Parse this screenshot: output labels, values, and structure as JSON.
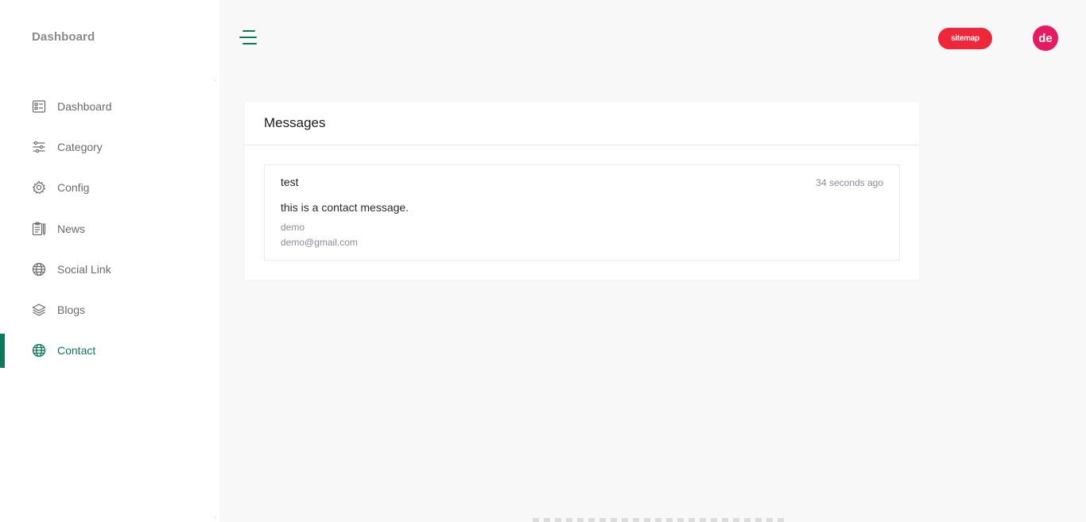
{
  "sidebar": {
    "brand": "Dashboard",
    "items": [
      {
        "label": "Dashboard",
        "icon": "dashboard-icon",
        "active": false
      },
      {
        "label": "Category",
        "icon": "sliders-icon",
        "active": false
      },
      {
        "label": "Config",
        "icon": "gear-icon",
        "active": false
      },
      {
        "label": "News",
        "icon": "clipboard-icon",
        "active": false
      },
      {
        "label": "Social Link",
        "icon": "globe-icon",
        "active": false
      },
      {
        "label": "Blogs",
        "icon": "layers-icon",
        "active": false
      },
      {
        "label": "Contact",
        "icon": "globe-icon",
        "active": true
      }
    ]
  },
  "header": {
    "menu_icon": "hamburger-icon",
    "sitemap_label": "sitemap",
    "avatar_initials": "de"
  },
  "colors": {
    "accent": "#0a7a5a",
    "sitemap": "#f0263a",
    "avatar": "#e8195f"
  },
  "card": {
    "title": "Messages",
    "messages": [
      {
        "subject": "test",
        "time": "34 seconds ago",
        "body": "this is a contact message.",
        "name": "demo",
        "email": "demo@gmail.com"
      }
    ]
  }
}
